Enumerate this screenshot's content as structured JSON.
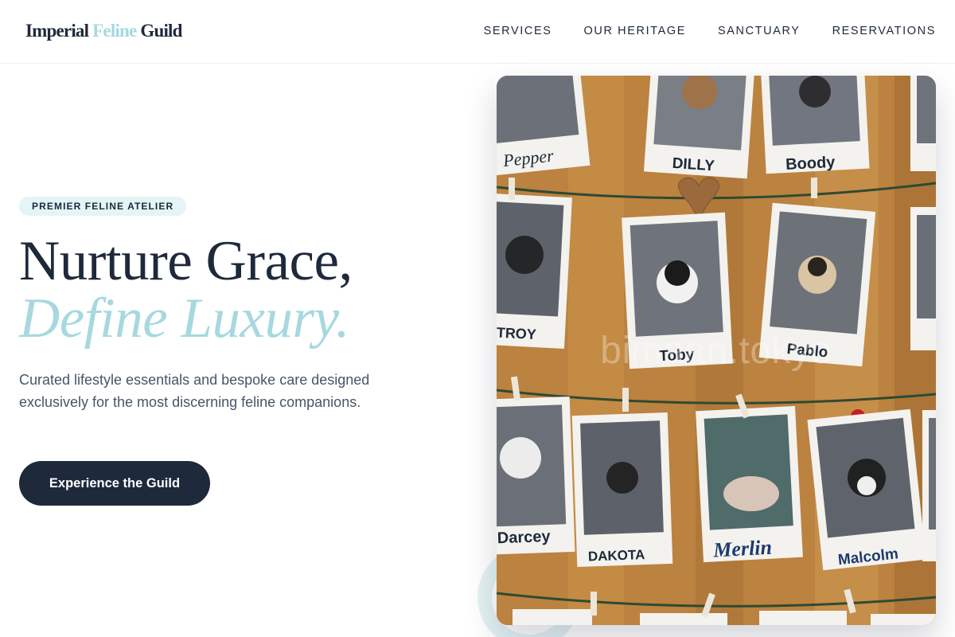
{
  "brand": {
    "part1": "Imperial",
    "part2": "Feline",
    "part3": "Guild"
  },
  "nav": {
    "services": "SERVICES",
    "heritage": "OUR HERITAGE",
    "sanctuary": "SANCTUARY",
    "reservations": "RESERVATIONS"
  },
  "hero": {
    "badge": "PREMIER FELINE ATELIER",
    "headline_line1": "Nurture Grace,",
    "headline_line2": "Define Luxury.",
    "subtext": "Curated lifestyle essentials and bespoke care designed exclusively for the most discerning feline companions.",
    "cta": "Experience the Guild"
  },
  "image": {
    "watermark": "bimaan.tokyo",
    "photo_names": [
      "Pepper",
      "DILLY",
      "Boody",
      "TROY",
      "Toby",
      "Pablo",
      "Darcey",
      "DAKOTA",
      "Merlin",
      "Malcolm"
    ]
  },
  "colors": {
    "primary": "#1e293b",
    "accent": "#a7d8df",
    "badge_bg": "#e5f4f6",
    "body_text": "#475569"
  }
}
